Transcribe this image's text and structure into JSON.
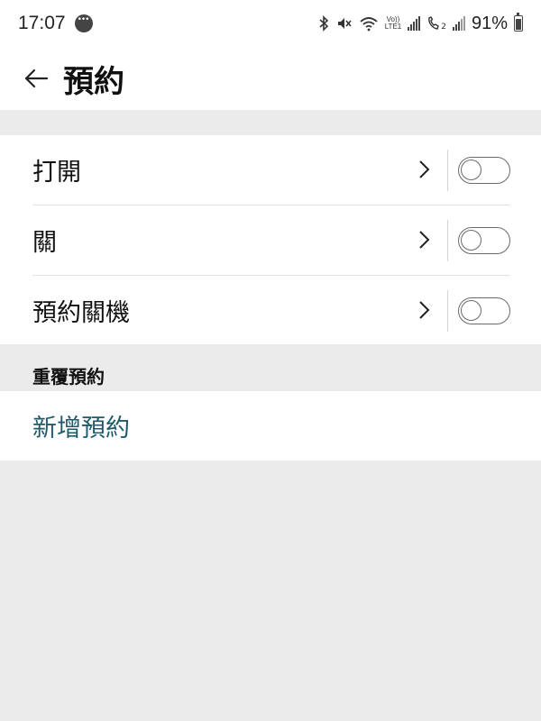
{
  "status_bar": {
    "time": "17:07",
    "volte_top": "Vo))",
    "volte_bottom": "LTE1",
    "sim2_label": "2",
    "battery_percent": "91%",
    "battery_level": 0.91
  },
  "header": {
    "title": "預約"
  },
  "schedule": {
    "items": [
      {
        "label": "打開",
        "enabled": false
      },
      {
        "label": "關",
        "enabled": false
      },
      {
        "label": "預約關機",
        "enabled": false
      }
    ]
  },
  "repeat_section": {
    "header": "重覆預約",
    "add_label": "新增預約"
  },
  "colors": {
    "accent_link": "#1f5a6b",
    "background": "#ebebeb",
    "surface": "#ffffff"
  }
}
